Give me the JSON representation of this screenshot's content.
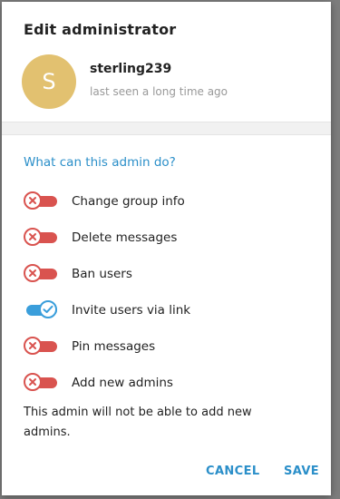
{
  "colors": {
    "accent": "#2b8fc9",
    "toggle_on": "#3a9edb",
    "toggle_off": "#d9534f",
    "avatar_bg": "#e2c170"
  },
  "dialog": {
    "title": "Edit administrator"
  },
  "user": {
    "avatar_letter": "S",
    "name": "sterling239",
    "status": "last seen a long time ago"
  },
  "permissions": {
    "heading": "What can this admin do?",
    "items": [
      {
        "label": "Change group info",
        "enabled": false,
        "icon": "x-icon"
      },
      {
        "label": "Delete messages",
        "enabled": false,
        "icon": "x-icon"
      },
      {
        "label": "Ban users",
        "enabled": false,
        "icon": "x-icon"
      },
      {
        "label": "Invite users via link",
        "enabled": true,
        "icon": "check-icon"
      },
      {
        "label": "Pin messages",
        "enabled": false,
        "icon": "x-icon"
      },
      {
        "label": "Add new admins",
        "enabled": false,
        "icon": "x-icon"
      }
    ]
  },
  "note": "This admin will not be able to add new admins.",
  "actions": {
    "cancel": "CANCEL",
    "save": "SAVE"
  }
}
